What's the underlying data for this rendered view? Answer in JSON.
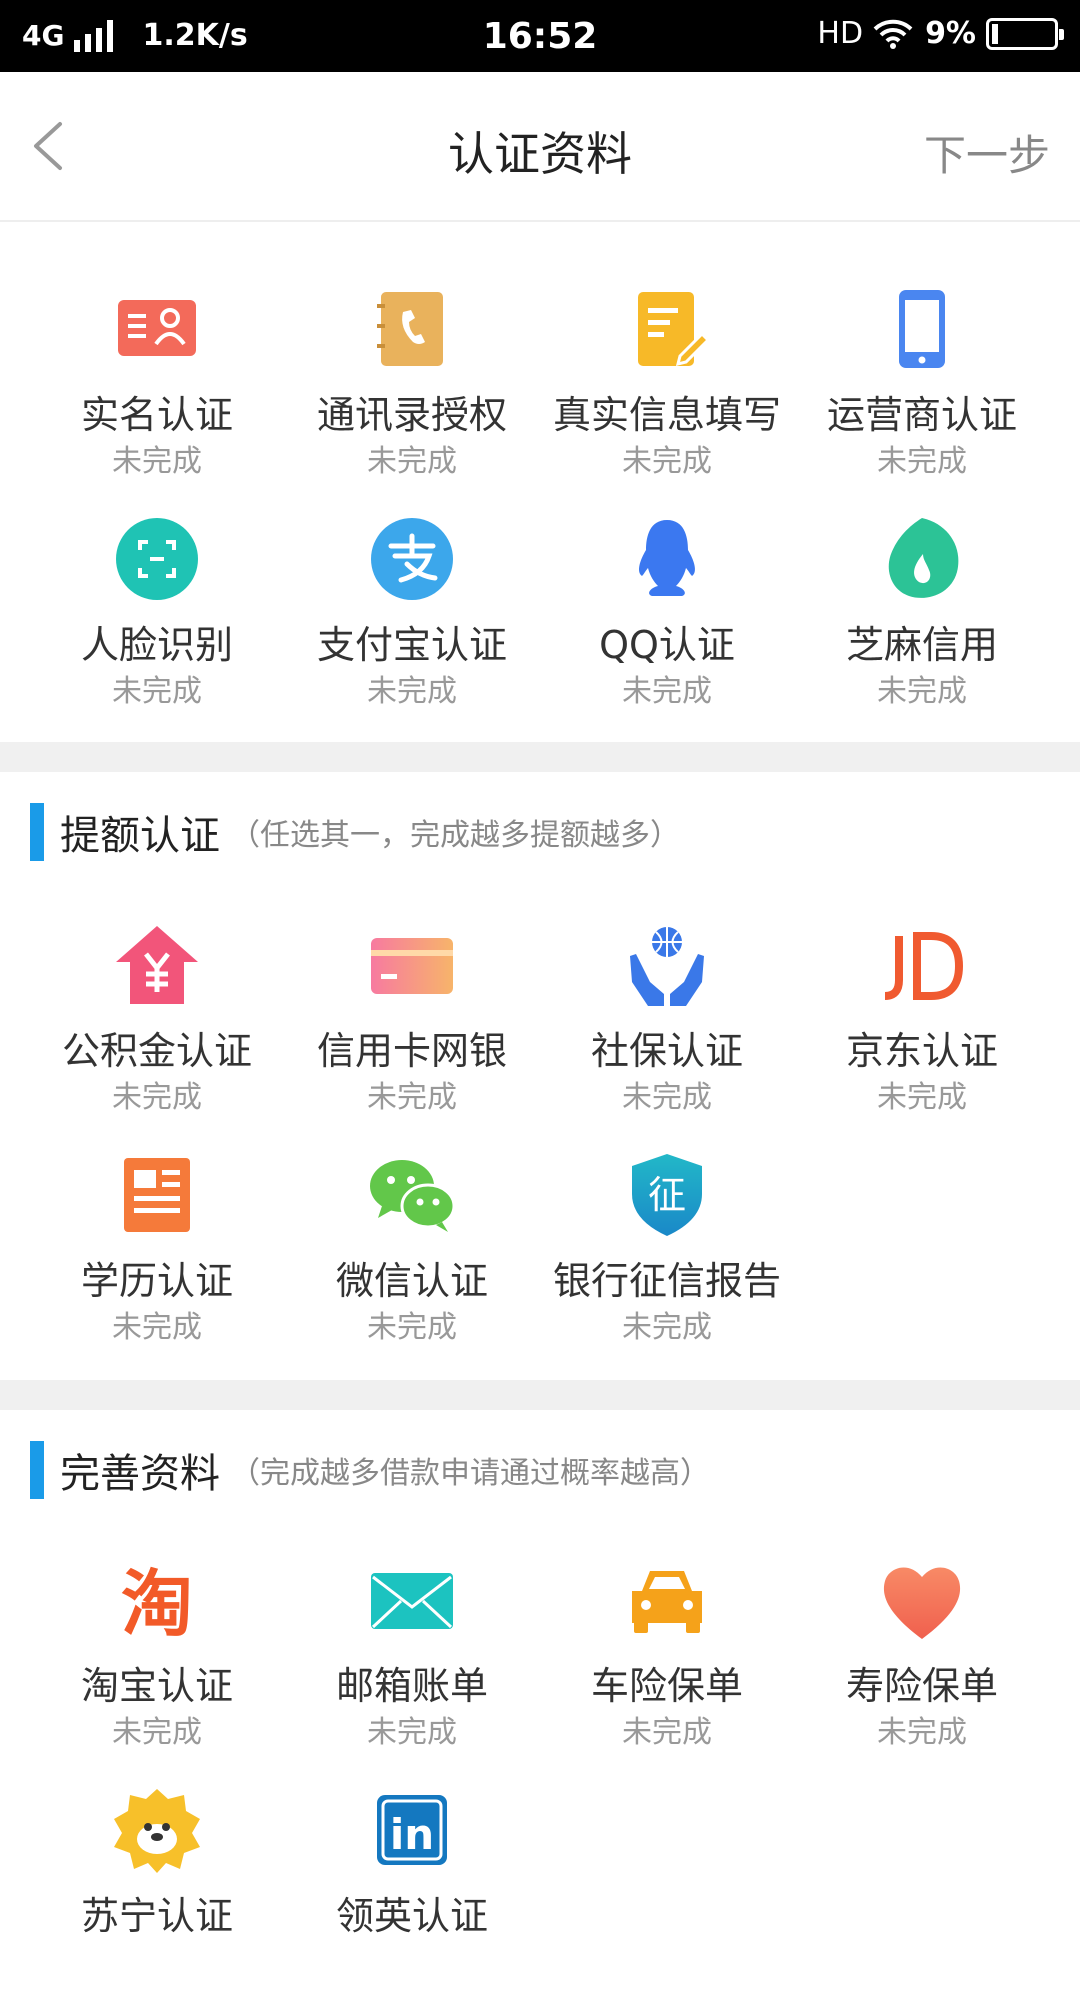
{
  "status_bar": {
    "network": "4G",
    "speed": "1.2K/s",
    "time": "16:52",
    "hd": "HD",
    "battery": "9%"
  },
  "nav": {
    "title": "认证资料",
    "next_label": "下一步"
  },
  "basic": {
    "items": [
      {
        "label": "实名认证",
        "status": "未完成",
        "icon": "id-card-icon",
        "color": "#f36a5a"
      },
      {
        "label": "通讯录授权",
        "status": "未完成",
        "icon": "contacts-book-icon",
        "color": "#e9b25c"
      },
      {
        "label": "真实信息填写",
        "status": "未完成",
        "icon": "form-edit-icon",
        "color": "#f7b928"
      },
      {
        "label": "运营商认证",
        "status": "未完成",
        "icon": "mobile-phone-icon",
        "color": "#4a86f0"
      },
      {
        "label": "人脸识别",
        "status": "未完成",
        "icon": "face-scan-icon",
        "color": "#1fc3b4"
      },
      {
        "label": "支付宝认证",
        "status": "未完成",
        "icon": "alipay-icon",
        "color": "#3ca7eb"
      },
      {
        "label": "QQ认证",
        "status": "未完成",
        "icon": "qq-penguin-icon",
        "color": "#3b78f0"
      },
      {
        "label": "芝麻信用",
        "status": "未完成",
        "icon": "sesame-credit-icon",
        "color": "#2cc396"
      }
    ]
  },
  "raise": {
    "title": "提额认证",
    "subtitle": "（任选其一，完成越多提额越多）",
    "items": [
      {
        "label": "公积金认证",
        "status": "未完成",
        "icon": "housing-fund-icon",
        "color": "#f2557a"
      },
      {
        "label": "信用卡网银",
        "status": "未完成",
        "icon": "credit-card-icon",
        "color": "#f58a8a"
      },
      {
        "label": "社保认证",
        "status": "未完成",
        "icon": "social-security-icon",
        "color": "#3a78e8"
      },
      {
        "label": "京东认证",
        "status": "未完成",
        "icon": "jd-logo-icon",
        "color": "#f05a30"
      },
      {
        "label": "学历认证",
        "status": "未完成",
        "icon": "education-icon",
        "color": "#f57a3a"
      },
      {
        "label": "微信认证",
        "status": "未完成",
        "icon": "wechat-icon",
        "color": "#62c74a"
      },
      {
        "label": "银行征信报告",
        "status": "未完成",
        "icon": "credit-report-shield-icon",
        "color": "#1aa0c8",
        "glyph": "征"
      }
    ]
  },
  "profile": {
    "title": "完善资料",
    "subtitle": "（完成越多借款申请通过概率越高）",
    "items": [
      {
        "label": "淘宝认证",
        "status": "未完成",
        "icon": "taobao-icon",
        "color": "#f25a28",
        "glyph": "淘"
      },
      {
        "label": "邮箱账单",
        "status": "未完成",
        "icon": "mail-envelope-icon",
        "color": "#1cc3c0"
      },
      {
        "label": "车险保单",
        "status": "未完成",
        "icon": "car-insurance-icon",
        "color": "#f5a21a"
      },
      {
        "label": "寿险保单",
        "status": "未完成",
        "icon": "heart-icon",
        "color": "#f5745a"
      },
      {
        "label": "苏宁认证",
        "status": "",
        "icon": "suning-lion-icon",
        "color": "#f7c02a"
      },
      {
        "label": "领英认证",
        "status": "",
        "icon": "linkedin-icon",
        "color": "#1478c0",
        "glyph": "in"
      }
    ]
  }
}
